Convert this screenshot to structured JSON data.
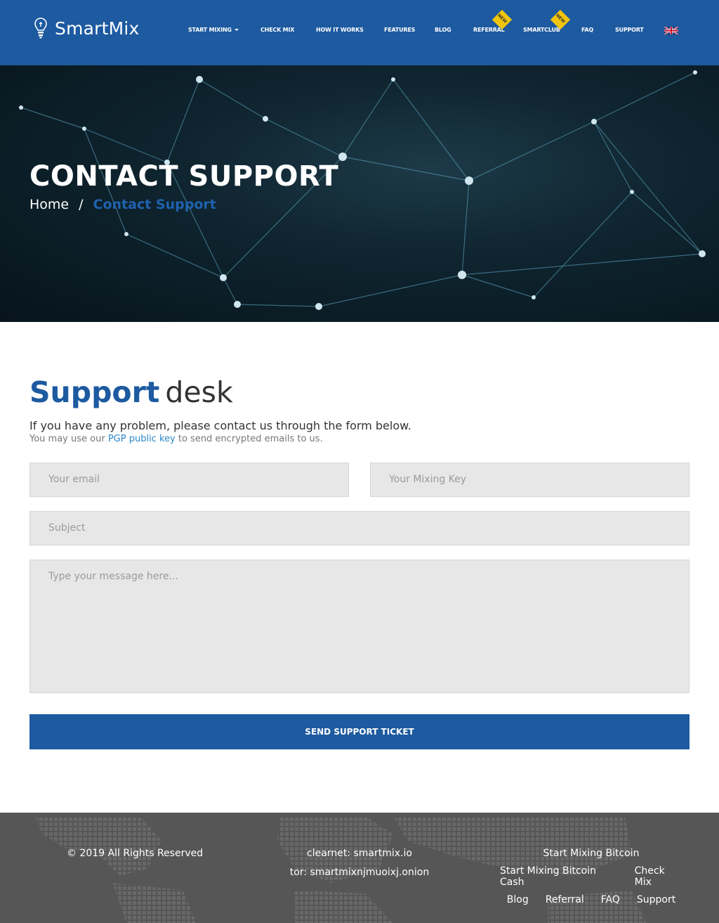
{
  "header": {
    "brand": "SmartMix",
    "nav": [
      {
        "label": "START MIXING",
        "has_caret": true
      },
      {
        "label": "CHECK MIX"
      },
      {
        "label": "HOW IT WORKS"
      },
      {
        "label": "FEATURES"
      },
      {
        "label": "BLOG"
      },
      {
        "label": "REFERRAL",
        "badge": "NEW"
      },
      {
        "label": "SMARTCLUB",
        "badge": "NEW"
      },
      {
        "label": "FAQ"
      },
      {
        "label": "SUPPORT"
      }
    ],
    "language_icon": "uk-flag-icon",
    "colors": {
      "navbar": "#1d5aa0",
      "badge": "#f1c40f"
    }
  },
  "hero": {
    "title": "CONTACT SUPPORT",
    "breadcrumb": {
      "home": "Home",
      "separator": "/",
      "current": "Contact Support"
    }
  },
  "main": {
    "title_bold": "Support",
    "title_light": "desk",
    "intro": "If you have any problem, please contact us through the form below.",
    "intro_small_before": "You may use our",
    "pgp_link": "PGP public key",
    "intro_small_after": "to send encrypted emails to us.",
    "form": {
      "email_placeholder": "Your email",
      "key_placeholder": "Your Mixing Key",
      "subject_placeholder": "Subject",
      "message_placeholder": "Type your message here...",
      "submit_label": "SEND SUPPORT TICKET"
    }
  },
  "footer": {
    "copyright": "© 2019 All Rights Reserved",
    "clearnet": "clearnet: smartmix.io",
    "tor": "tor: smartmixnjmuoixj.onion",
    "links": [
      [
        "Start Mixing Bitcoin"
      ],
      [
        "Start Mixing Bitcoin Cash",
        "Check Mix"
      ],
      [
        "Blog",
        "Referral",
        "FAQ",
        "Support"
      ]
    ]
  }
}
